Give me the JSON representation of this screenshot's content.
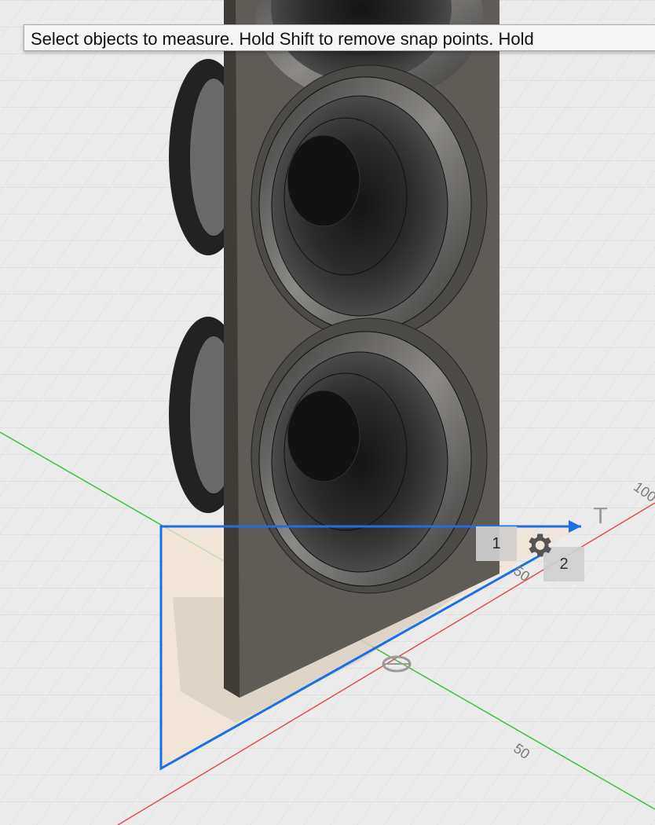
{
  "tooltip": {
    "text": "Select objects to measure. Hold Shift to remove snap points. Hold"
  },
  "badges": {
    "first": "1",
    "second": "2"
  },
  "axis_labels": {
    "a": "100",
    "b": "50",
    "c": "50"
  },
  "icons": {
    "gear": "gear-icon",
    "text_tool": "text-tool-icon"
  },
  "colors": {
    "selection_blue": "#1e6fe0",
    "x_axis": "#e05050",
    "y_axis": "#3bc43b",
    "panel": "#5f5c57",
    "grid": "#d6d6d6"
  }
}
